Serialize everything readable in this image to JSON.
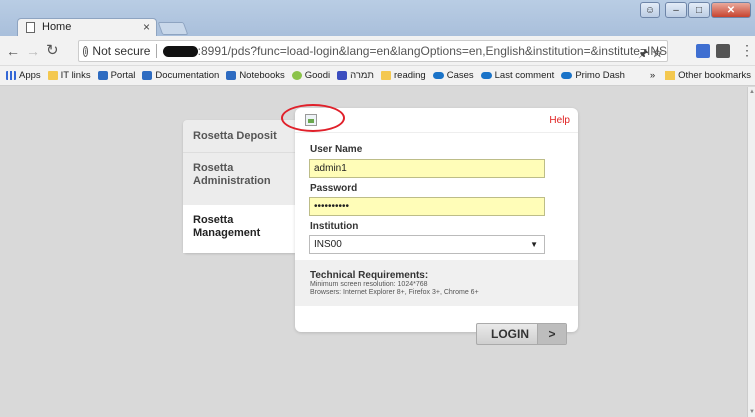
{
  "browser": {
    "tab_title": "Home",
    "tab_close": "×",
    "not_secure": "Not secure",
    "url": ":8991/pds?func=load-login&lang=en&langOptions=en,English&institution=&institute=INS"
  },
  "bookmarks": [
    {
      "label": "Apps",
      "icon": "apps-icon"
    },
    {
      "label": "IT links",
      "icon": "folder-icon"
    },
    {
      "label": "Portal",
      "icon": "site-icon"
    },
    {
      "label": "Documentation",
      "icon": "site-icon"
    },
    {
      "label": "Notebooks",
      "icon": "site-icon"
    },
    {
      "label": "Goodi",
      "icon": "goodi-icon"
    },
    {
      "label": "תמרה",
      "icon": "site-icon"
    },
    {
      "label": "reading",
      "icon": "folder-icon"
    },
    {
      "label": "Cases",
      "icon": "cloud-icon"
    },
    {
      "label": "Last comment",
      "icon": "cloud-icon"
    },
    {
      "label": "Primo Dash",
      "icon": "cloud-icon"
    }
  ],
  "bookmarks_overflow": "»",
  "other_bookmarks": "Other bookmarks",
  "nav": {
    "deposit": "Rosetta Deposit",
    "administration": "Rosetta Administration",
    "management": "Rosetta Management"
  },
  "form": {
    "help": "Help",
    "username_label": "User Name",
    "username_value": "admin1",
    "password_label": "Password",
    "password_value": "••••••••••",
    "institution_label": "Institution",
    "institution_value": "INS00",
    "tech_title": "Technical Requirements:",
    "tech_resolution": "Minimum screen resolution: 1024*768",
    "tech_browsers": "Browsers: Internet Explorer 8+, Firefox 3+, Chrome 6+"
  },
  "login": {
    "label": "LOGIN",
    "arrow": ">"
  },
  "colors": {
    "help": "#e02020",
    "input_bg": "#fffdb8",
    "annotation": "#e0202a"
  }
}
